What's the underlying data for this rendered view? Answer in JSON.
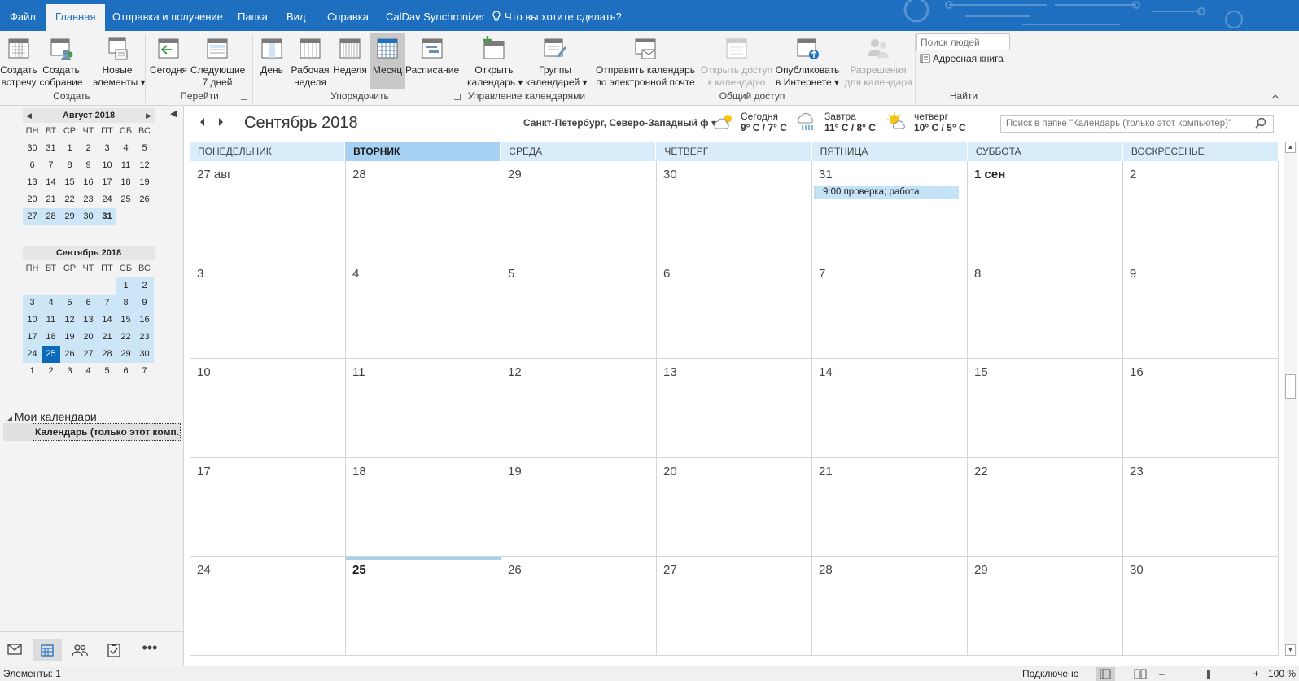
{
  "tabs": [
    "Файл",
    "Главная",
    "Отправка и получение",
    "Папка",
    "Вид",
    "Справка",
    "CalDav Synchronizer"
  ],
  "tell_me": "Что вы хотите сделать?",
  "ribbon": {
    "create_meeting": "Создать\nвстречу",
    "create_gathering": "Создать\nсобрание",
    "new_items": "Новые\nэлементы ▾",
    "today": "Сегодня",
    "next7": "Следующие\n7 дней",
    "day": "День",
    "work_week": "Рабочая\nнеделя",
    "week": "Неделя",
    "month": "Месяц",
    "schedule": "Расписание",
    "open_calendar": "Открыть\nкалендарь ▾",
    "calendar_groups": "Группы\nкалендарей ▾",
    "send_calendar": "Отправить календарь\nпо электронной почте",
    "share_calendar": "Открыть доступ\nк календарю",
    "publish_online": "Опубликовать\nв Интернете ▾",
    "permissions": "Разрешения\nдля календаря",
    "people_search_placeholder": "Поиск людей",
    "address_book": "Адресная книга",
    "groups": {
      "create": "Создать",
      "goto": "Перейти",
      "arrange": "Упорядочить",
      "manage": "Управление календарями",
      "share": "Общий доступ",
      "find": "Найти"
    }
  },
  "mini_august": {
    "title": "Август 2018",
    "weekdays": [
      "ПН",
      "ВТ",
      "СР",
      "ЧТ",
      "ПТ",
      "СБ",
      "ВС"
    ],
    "days": [
      "30",
      "31",
      "1",
      "2",
      "3",
      "4",
      "5",
      "6",
      "7",
      "8",
      "9",
      "10",
      "11",
      "12",
      "13",
      "14",
      "15",
      "16",
      "17",
      "18",
      "19",
      "20",
      "21",
      "22",
      "23",
      "24",
      "25",
      "26",
      "27",
      "28",
      "29",
      "30",
      "31"
    ]
  },
  "mini_september": {
    "title": "Сентябрь 2018",
    "weekdays": [
      "ПН",
      "ВТ",
      "СР",
      "ЧТ",
      "ПТ",
      "СБ",
      "ВС"
    ],
    "days": [
      "",
      "",
      "",
      "",
      "",
      "1",
      "2",
      "3",
      "4",
      "5",
      "6",
      "7",
      "8",
      "9",
      "10",
      "11",
      "12",
      "13",
      "14",
      "15",
      "16",
      "17",
      "18",
      "19",
      "20",
      "21",
      "22",
      "23",
      "24",
      "25",
      "26",
      "27",
      "28",
      "29",
      "30",
      "1",
      "2",
      "3",
      "4",
      "5",
      "6",
      "7"
    ]
  },
  "my_calendars": "Мои календари",
  "calendar_item": "Календарь (только этот комп...",
  "month_title": "Сентябрь 2018",
  "location": "Санкт-Петербург, Северо-Западный ф ▾",
  "weather": [
    {
      "label": "Сегодня",
      "temp": "9° C / 7° C"
    },
    {
      "label": "Завтра",
      "temp": "11° C / 8° C"
    },
    {
      "label": "четверг",
      "temp": "10° C / 5° C"
    }
  ],
  "folder_search_placeholder": "Поиск в папке \"Календарь (только этот компьютер)\"",
  "day_headers": [
    "ПОНЕДЕЛЬНИК",
    "ВТОРНИК",
    "СРЕДА",
    "ЧЕТВЕРГ",
    "ПЯТНИЦА",
    "СУББОТА",
    "ВОСКРЕСЕНЬЕ"
  ],
  "weeks": [
    [
      "27 авг",
      "28",
      "29",
      "30",
      "31",
      "1 сен",
      "2"
    ],
    [
      "3",
      "4",
      "5",
      "6",
      "7",
      "8",
      "9"
    ],
    [
      "10",
      "11",
      "12",
      "13",
      "14",
      "15",
      "16"
    ],
    [
      "17",
      "18",
      "19",
      "20",
      "21",
      "22",
      "23"
    ],
    [
      "24",
      "25",
      "26",
      "27",
      "28",
      "29",
      "30"
    ]
  ],
  "event": "9:00 проверка; работа",
  "status": {
    "items": "Элементы: 1",
    "connection": "Подключено",
    "zoom": "100 %"
  }
}
